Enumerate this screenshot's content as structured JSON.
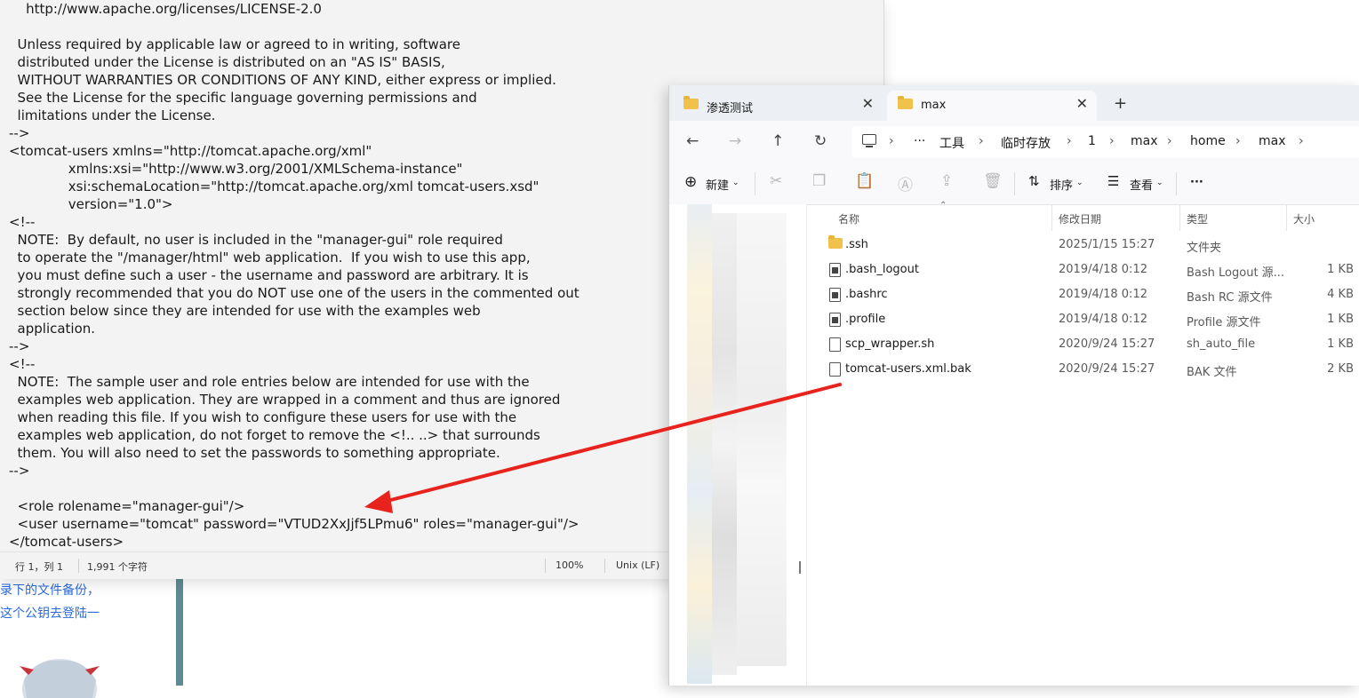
{
  "background_page": {
    "lines": [
      "录下的文件备份，",
      "这个公钥去登陆一"
    ]
  },
  "notepad": {
    "lines": [
      "    http://www.apache.org/licenses/LICENSE-2.0",
      "",
      "  Unless required by applicable law or agreed to in writing, software",
      "  distributed under the License is distributed on an \"AS IS\" BASIS,",
      "  WITHOUT WARRANTIES OR CONDITIONS OF ANY KIND, either express or implied.",
      "  See the License for the specific language governing permissions and",
      "  limitations under the License.",
      "-->",
      "<tomcat-users xmlns=\"http://tomcat.apache.org/xml\"",
      "              xmlns:xsi=\"http://www.w3.org/2001/XMLSchema-instance\"",
      "              xsi:schemaLocation=\"http://tomcat.apache.org/xml tomcat-users.xsd\"",
      "              version=\"1.0\">",
      "<!--",
      "  NOTE:  By default, no user is included in the \"manager-gui\" role required",
      "  to operate the \"/manager/html\" web application.  If you wish to use this app,",
      "  you must define such a user - the username and password are arbitrary. It is",
      "  strongly recommended that you do NOT use one of the users in the commented out",
      "  section below since they are intended for use with the examples web",
      "  application.",
      "-->",
      "<!--",
      "  NOTE:  The sample user and role entries below are intended for use with the",
      "  examples web application. They are wrapped in a comment and thus are ignored",
      "  when reading this file. If you wish to configure these users for use with the",
      "  examples web application, do not forget to remove the <!.. ..> that surrounds",
      "  them. You will also need to set the passwords to something appropriate.",
      "-->",
      "",
      "  <role rolename=\"manager-gui\"/>",
      "  <user username=\"tomcat\" password=\"VTUD2XxJjf5LPmu6\" roles=\"manager-gui\"/>",
      "</tomcat-users>"
    ],
    "status": {
      "position": "行 1，列 1",
      "chars": "1,991 个字符",
      "zoom": "100%",
      "eol": "Unix (LF)"
    }
  },
  "explorer": {
    "tabs": [
      {
        "label": "渗透测试",
        "active": false
      },
      {
        "label": "max",
        "active": true
      }
    ],
    "add_tab": "+",
    "nav": {
      "back": "←",
      "forward": "→",
      "up": "↑",
      "refresh": "↻"
    },
    "breadcrumb": {
      "more": "···",
      "items": [
        "工具",
        "临时存放",
        "1",
        "max",
        "home",
        "max"
      ],
      "separator": "›"
    },
    "toolbar": {
      "new_label": "新建",
      "sort_label": "排序",
      "view_label": "查看",
      "more_label": "···"
    },
    "columns": {
      "name": "名称",
      "date": "修改日期",
      "type": "类型",
      "size": "大小"
    },
    "files": [
      {
        "name": ".ssh",
        "date": "2025/1/15 15:27",
        "type": "文件夹",
        "size": "",
        "icon": "folder-icon"
      },
      {
        "name": ".bash_logout",
        "date": "2019/4/18 0:12",
        "type": "Bash Logout 源...",
        "size": "1 KB",
        "icon": "source-file-icon"
      },
      {
        "name": ".bashrc",
        "date": "2019/4/18 0:12",
        "type": "Bash RC 源文件",
        "size": "4 KB",
        "icon": "source-file-icon"
      },
      {
        "name": ".profile",
        "date": "2019/4/18 0:12",
        "type": "Profile 源文件",
        "size": "1 KB",
        "icon": "source-file-icon"
      },
      {
        "name": "scp_wrapper.sh",
        "date": "2020/9/24 15:27",
        "type": "sh_auto_file",
        "size": "1 KB",
        "icon": "file-icon"
      },
      {
        "name": "tomcat-users.xml.bak",
        "date": "2020/9/24 15:27",
        "type": "BAK 文件",
        "size": "2 KB",
        "icon": "file-icon"
      }
    ]
  },
  "colors": {
    "annotation_arrow": "#e8231e",
    "folder": "#f0c14b",
    "link_text": "#2b6cd9"
  }
}
